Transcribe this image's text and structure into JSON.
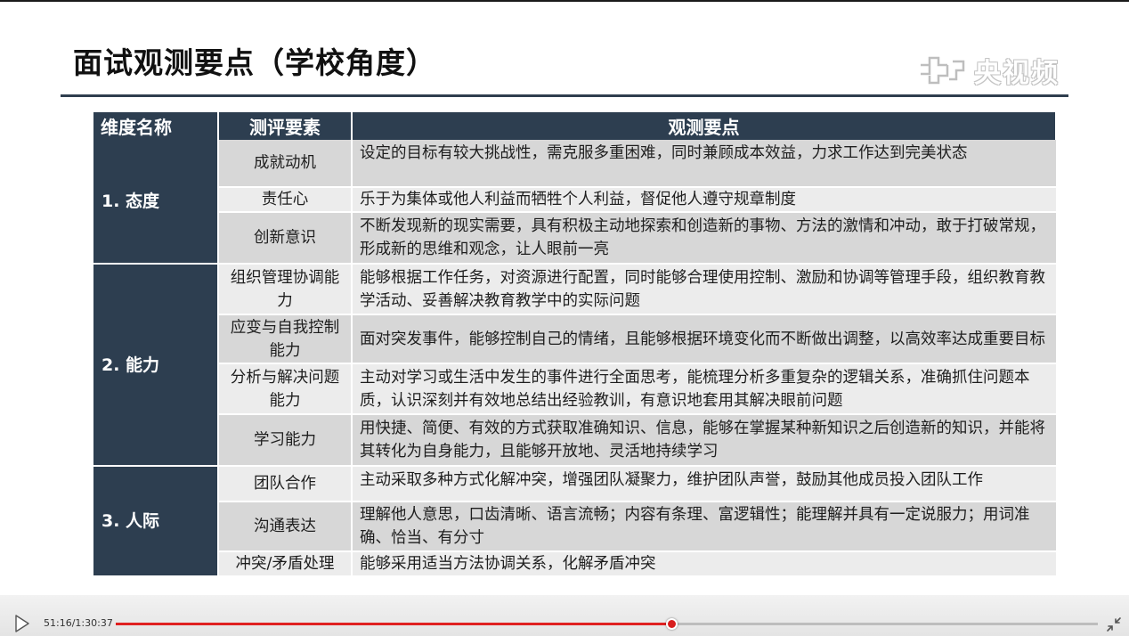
{
  "slide": {
    "title": "面试观测要点（学校角度）",
    "watermark": "央视频",
    "table": {
      "headers": [
        "维度名称",
        "测评要素",
        "观测要点"
      ],
      "dimensions": [
        {
          "name": "1. 态度",
          "rows": [
            {
              "element": "成就动机",
              "point": "设定的目标有较大挑战性，需克服多重困难，同时兼顾成本效益，力求工作达到完美状态"
            },
            {
              "element": "责任心",
              "point": "乐于为集体或他人利益而牺牲个人利益，督促他人遵守规章制度"
            },
            {
              "element": "创新意识",
              "point": "不断发现新的现实需要，具有积极主动地探索和创造新的事物、方法的激情和冲动，敢于打破常规，形成新的思维和观念，让人眼前一亮"
            }
          ]
        },
        {
          "name": "2. 能力",
          "rows": [
            {
              "element": "组织管理协调能力",
              "point": "能够根据工作任务，对资源进行配置，同时能够合理使用控制、激励和协调等管理手段，组织教育教学活动、妥善解决教育教学中的实际问题"
            },
            {
              "element": "应变与自我控制能力",
              "point": "面对突发事件，能够控制自己的情绪，且能够根据环境变化而不断做出调整，以高效率达成重要目标"
            },
            {
              "element": "分析与解决问题能力",
              "point": "主动对学习或生活中发生的事件进行全面思考，能梳理分析多重复杂的逻辑关系，准确抓住问题本质，认识深刻并有效地总结出经验教训，有意识地套用其解决眼前问题"
            },
            {
              "element": "学习能力",
              "point": "用快捷、简便、有效的方式获取准确知识、信息，能够在掌握某种新知识之后创造新的知识，并能将其转化为自身能力，且能够开放地、灵活地持续学习"
            }
          ]
        },
        {
          "name": "3. 人际",
          "rows": [
            {
              "element": "团队合作",
              "point": "主动采取多种方式化解冲突，增强团队凝聚力，维护团队声誉，鼓励其他成员投入团队工作"
            },
            {
              "element": "沟通表达",
              "point": "理解他人意思，口齿清晰、语言流畅；内容有条理、富逻辑性；能理解并具有一定说服力；用词准确、恰当、有分寸"
            },
            {
              "element": "冲突/矛盾处理",
              "point": "能够采用适当方法协调关系，化解矛盾冲突"
            }
          ]
        }
      ]
    }
  },
  "player": {
    "time": "51:16/1:30:37",
    "progress": 0.5657,
    "accent": "#e02020"
  }
}
